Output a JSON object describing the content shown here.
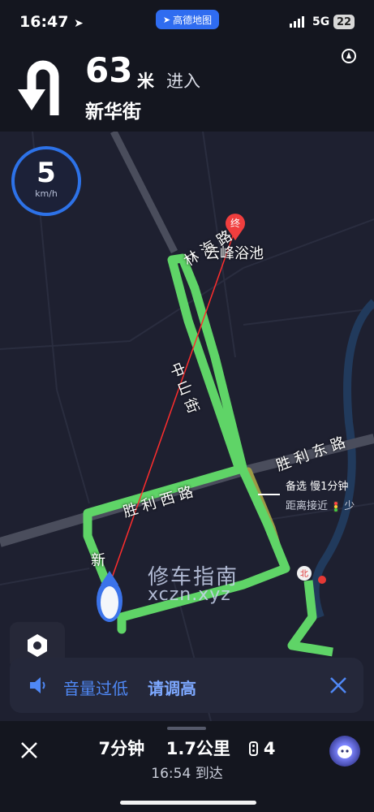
{
  "status_bar": {
    "time": "16:47",
    "app": "高德地图",
    "network": "5G",
    "battery": "22"
  },
  "nav": {
    "distance": "63",
    "unit": "米",
    "action": "进入",
    "street": "新华街"
  },
  "speed": {
    "value": "5",
    "unit": "km/h"
  },
  "map": {
    "dest_marker": "终",
    "north_marker": "北",
    "labels": [
      "林 海 路",
      "云峰浴池",
      "中 山 街",
      "胜 利 东 路",
      "胜 利 西 路",
      "新"
    ],
    "alt_route_title": "备选 慢1分钟",
    "alt_route_detail": "距离接近",
    "alt_route_tail": "少",
    "watermark_cn": "修车指南",
    "watermark_url": "xczn.xyz"
  },
  "notice": {
    "text": "音量过低",
    "action": "请调高"
  },
  "summary": {
    "time": "7分钟",
    "distance": "1.7公里",
    "lights": "4",
    "arrival": "16:54 到达"
  },
  "colors": {
    "route": "#5fd467",
    "accent": "#2f6cf0",
    "background": "#1b1d2b"
  }
}
